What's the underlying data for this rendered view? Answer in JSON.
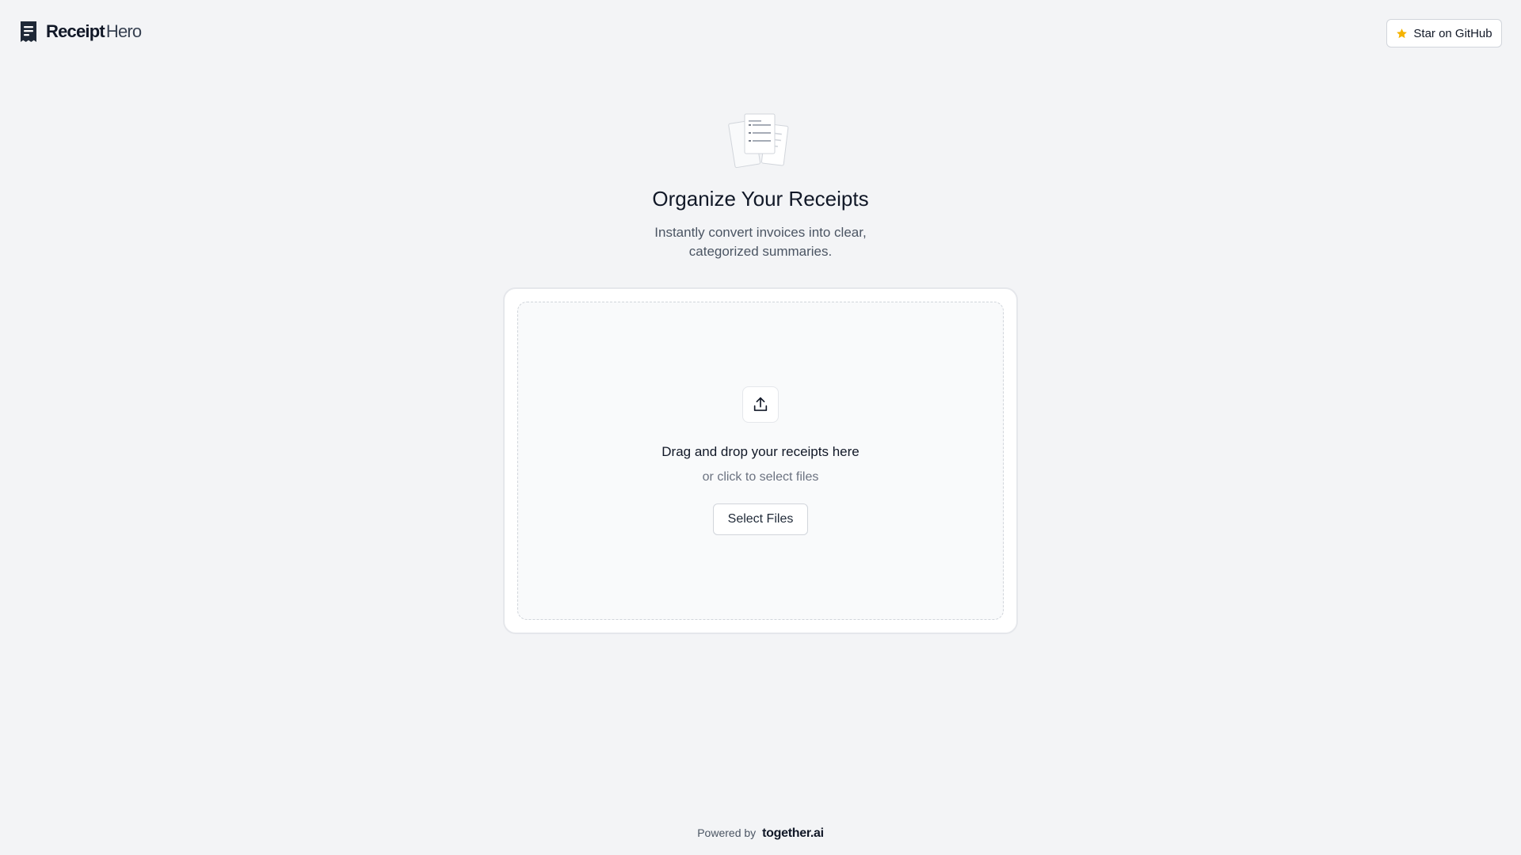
{
  "header": {
    "logo": {
      "name_primary": "Receipt",
      "name_secondary": "Hero",
      "icon": "receipt-icon"
    },
    "github_button": {
      "label": "Star on GitHub",
      "icon": "star-icon",
      "icon_color": "#f5b301"
    }
  },
  "hero": {
    "illustration": "receipts-illustration",
    "title": "Organize Your Receipts",
    "subtitle": "Instantly convert invoices into clear, categorized summaries."
  },
  "upload": {
    "icon": "upload-icon",
    "title": "Drag and drop your receipts here",
    "subtitle": "or click to select files",
    "button_label": "Select Files"
  },
  "footer": {
    "powered_by_label": "Powered by",
    "brand": "together.ai"
  },
  "colors": {
    "background": "#f3f4f6",
    "text": "#111827",
    "muted_text": "#6b7280",
    "border": "#d1d5db"
  }
}
